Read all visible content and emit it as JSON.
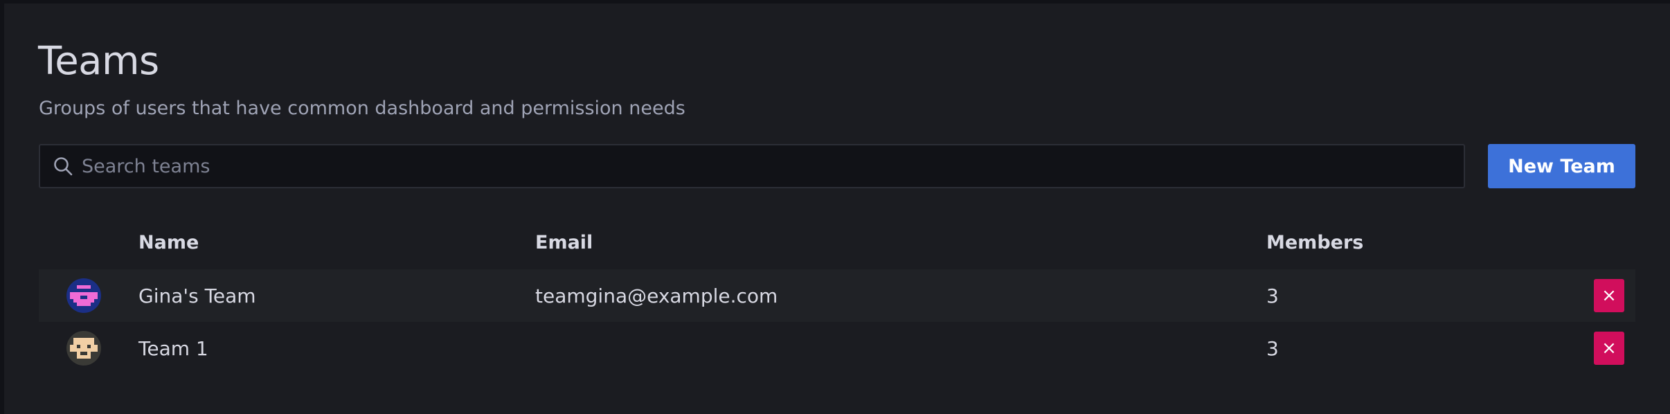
{
  "page": {
    "title": "Teams",
    "subtitle": "Groups of users that have common dashboard and permission needs"
  },
  "search": {
    "placeholder": "Search teams",
    "value": "",
    "icon": "search-icon"
  },
  "actions": {
    "new_team_label": "New Team"
  },
  "table": {
    "columns": [
      "Name",
      "Email",
      "Members"
    ],
    "rows": [
      {
        "name": "Gina's Team",
        "email": "teamgina@example.com",
        "members": "3",
        "avatar": "pixel-avatar-blue-pink",
        "delete_label": "×"
      },
      {
        "name": "Team 1",
        "email": "",
        "members": "3",
        "avatar": "pixel-avatar-dark-tan",
        "delete_label": "×"
      }
    ]
  },
  "colors": {
    "background": "#1b1c21",
    "primary_button": "#3d71d9",
    "danger_button": "#d10e5c"
  }
}
